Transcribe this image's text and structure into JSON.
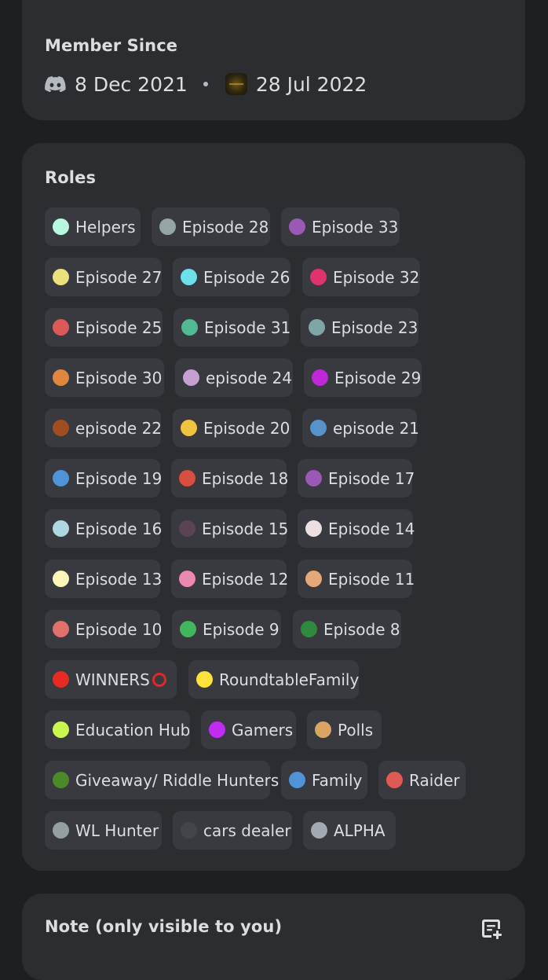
{
  "member_since": {
    "title": "Member Since",
    "discord_date": "8 Dec 2021",
    "server_date": "28 Jul 2022",
    "icons": [
      "discord-icon",
      "server-icon"
    ]
  },
  "roles": {
    "title": "Roles",
    "items": [
      {
        "label": "Helpers",
        "color": "#b9f8e0"
      },
      {
        "label": "Episode 28",
        "color": "#95a5a6"
      },
      {
        "label": "Episode 33",
        "color": "#9b59b6"
      },
      {
        "label": "Episode 27",
        "color": "#e9e27c"
      },
      {
        "label": "Episode 26",
        "color": "#6ee0ea"
      },
      {
        "label": "Episode 32",
        "color": "#e0336d"
      },
      {
        "label": "Episode 25",
        "color": "#db5a55"
      },
      {
        "label": "Episode 31",
        "color": "#4fba94"
      },
      {
        "label": "Episode 23",
        "color": "#7fa6a6"
      },
      {
        "label": "Episode 30",
        "color": "#e0873f"
      },
      {
        "label": "episode 24",
        "color": "#c4a1cf"
      },
      {
        "label": "Episode 29",
        "color": "#c127d8"
      },
      {
        "label": "episode 22",
        "color": "#a04d1f"
      },
      {
        "label": "Episode 20",
        "color": "#efc33f"
      },
      {
        "label": "episode 21",
        "color": "#5593c9"
      },
      {
        "label": "Episode 19",
        "color": "#4f93d8"
      },
      {
        "label": "Episode 18",
        "color": "#d84f3f"
      },
      {
        "label": "Episode 17",
        "color": "#9b59b6"
      },
      {
        "label": "Episode 16",
        "color": "#add7e1"
      },
      {
        "label": "Episode 15",
        "color": "#5b4356"
      },
      {
        "label": "Episode 14",
        "color": "#ece0e4"
      },
      {
        "label": "Episode 13",
        "color": "#fbf6b7"
      },
      {
        "label": "Episode 12",
        "color": "#ea89b2"
      },
      {
        "label": "Episode 11",
        "color": "#e7a879"
      },
      {
        "label": "Episode 10",
        "color": "#e0706a"
      },
      {
        "label": "Episode 9",
        "color": "#43b55a"
      },
      {
        "label": "Episode 8",
        "color": "#2f8a3e"
      },
      {
        "label": "WINNERS",
        "color": "#e82a25",
        "suffix_icon": "red-ring-icon"
      },
      {
        "label": "RoundtableFamily",
        "color": "#fde13c"
      },
      {
        "label": "Education Hub",
        "color": "#c9f74e"
      },
      {
        "label": "Gamers",
        "color": "#c12cf3"
      },
      {
        "label": "Polls",
        "color": "#d9a464"
      },
      {
        "label": "Giveaway/ Riddle Hunters",
        "color": "#4b8a28"
      },
      {
        "label": "Family",
        "color": "#4f93d8"
      },
      {
        "label": "Raider",
        "color": "#e05a55"
      },
      {
        "label": "WL Hunter",
        "color": "#95a09e"
      },
      {
        "label": "cars dealer",
        "color": "#43454b"
      },
      {
        "label": "ALPHA",
        "color": "#a3a9b0"
      }
    ]
  },
  "note": {
    "title": "Note (only visible to you)",
    "icon": "add-note-icon"
  }
}
